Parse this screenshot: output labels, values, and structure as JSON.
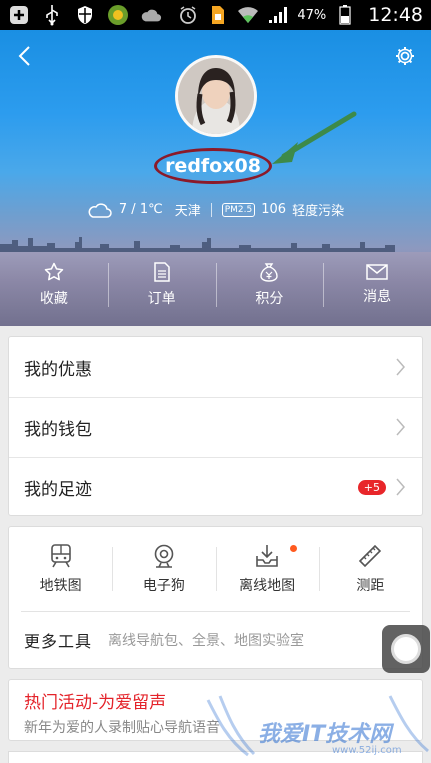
{
  "status_bar": {
    "battery_percent": "47%",
    "time": "12:48",
    "icons": [
      "add-icon",
      "usb-icon",
      "shield-icon",
      "app-icon",
      "cloud-icon",
      "alarm-icon",
      "sim-icon",
      "wifi-icon",
      "signal-icon",
      "battery-icon"
    ]
  },
  "header": {
    "username": "redfox08",
    "weather": {
      "temperature": "7 / 1℃",
      "city": "天津",
      "pm_label": "PM2.5",
      "pm_value": "106",
      "air_quality": "轻度污染"
    },
    "quick_actions": [
      {
        "label": "收藏",
        "icon": "star-icon"
      },
      {
        "label": "订单",
        "icon": "document-icon"
      },
      {
        "label": "积分",
        "icon": "money-bag-icon"
      },
      {
        "label": "消息",
        "icon": "mail-icon"
      }
    ]
  },
  "list": {
    "items": [
      {
        "label": "我的优惠"
      },
      {
        "label": "我的钱包"
      },
      {
        "label": "我的足迹",
        "badge": "+5"
      }
    ]
  },
  "tools": {
    "items": [
      {
        "label": "地铁图",
        "icon": "subway-icon"
      },
      {
        "label": "电子狗",
        "icon": "camera-dog-icon"
      },
      {
        "label": "离线地图",
        "icon": "offline-map-icon",
        "dot": true
      },
      {
        "label": "测距",
        "icon": "ruler-icon"
      }
    ],
    "more_title": "更多工具",
    "more_desc": "离线导航包、全景、地图实验室"
  },
  "promo": {
    "title": "热门活动-为爱留声",
    "desc": "新年为爱的人录制贴心导航语音"
  },
  "watermark": {
    "text": "我爱IT技术网",
    "url": "www.52ij.com"
  },
  "colors": {
    "header_blue": "#1a8fe3",
    "badge_red": "#e8262a",
    "promo_red": "#e4232a",
    "ellipse_red": "#8b1a2a",
    "arrow_green": "#3d8a4a"
  }
}
